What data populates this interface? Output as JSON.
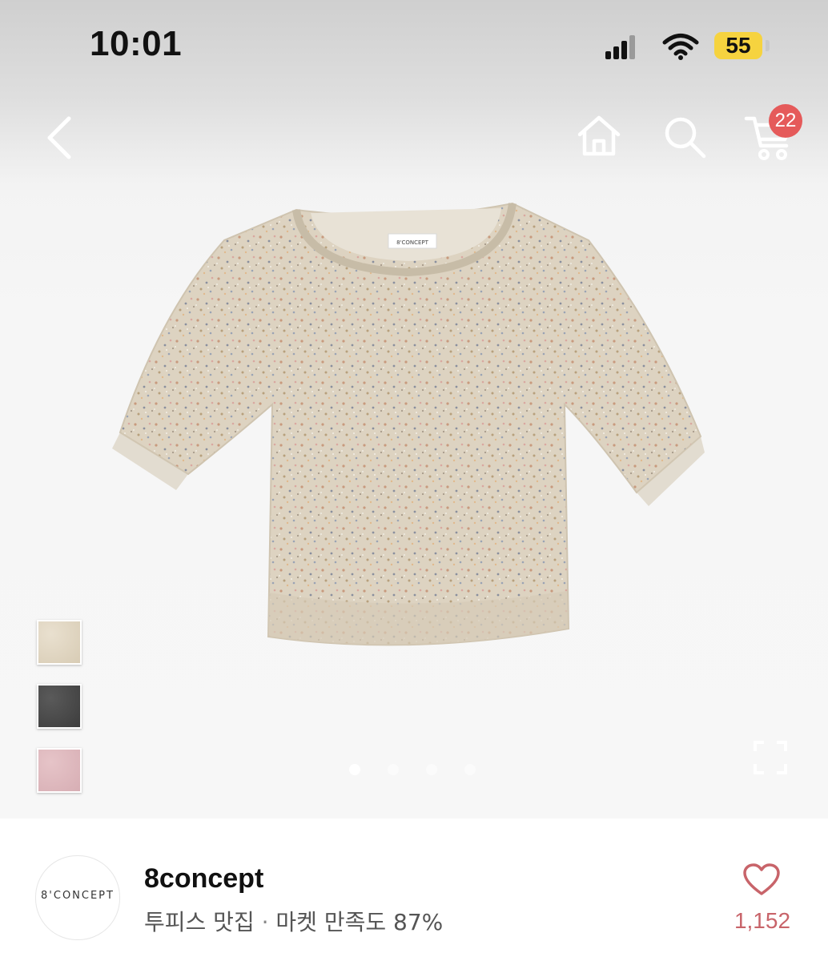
{
  "status_bar": {
    "time": "10:01",
    "battery": "55"
  },
  "nav": {
    "cart_count": "22"
  },
  "product": {
    "label_text": "8'CONCEPT",
    "variants": [
      "beige",
      "charcoal",
      "pink"
    ],
    "carousel_pages": 4,
    "carousel_active": 1
  },
  "shop": {
    "logo_text": "8'CONCEPT",
    "name": "8concept",
    "tag": "투피스 맛집",
    "separator": " · ",
    "satisfaction": "마켓 만족도 87%",
    "likes": "1,152"
  },
  "colors": {
    "badge": "#e55a5a",
    "battery": "#f6d33f",
    "like": "#c8646a",
    "sweater": "#ddd3c1"
  },
  "icons": [
    "back-icon",
    "home-icon",
    "search-icon",
    "cart-icon",
    "fullscreen-icon",
    "heart-icon"
  ]
}
